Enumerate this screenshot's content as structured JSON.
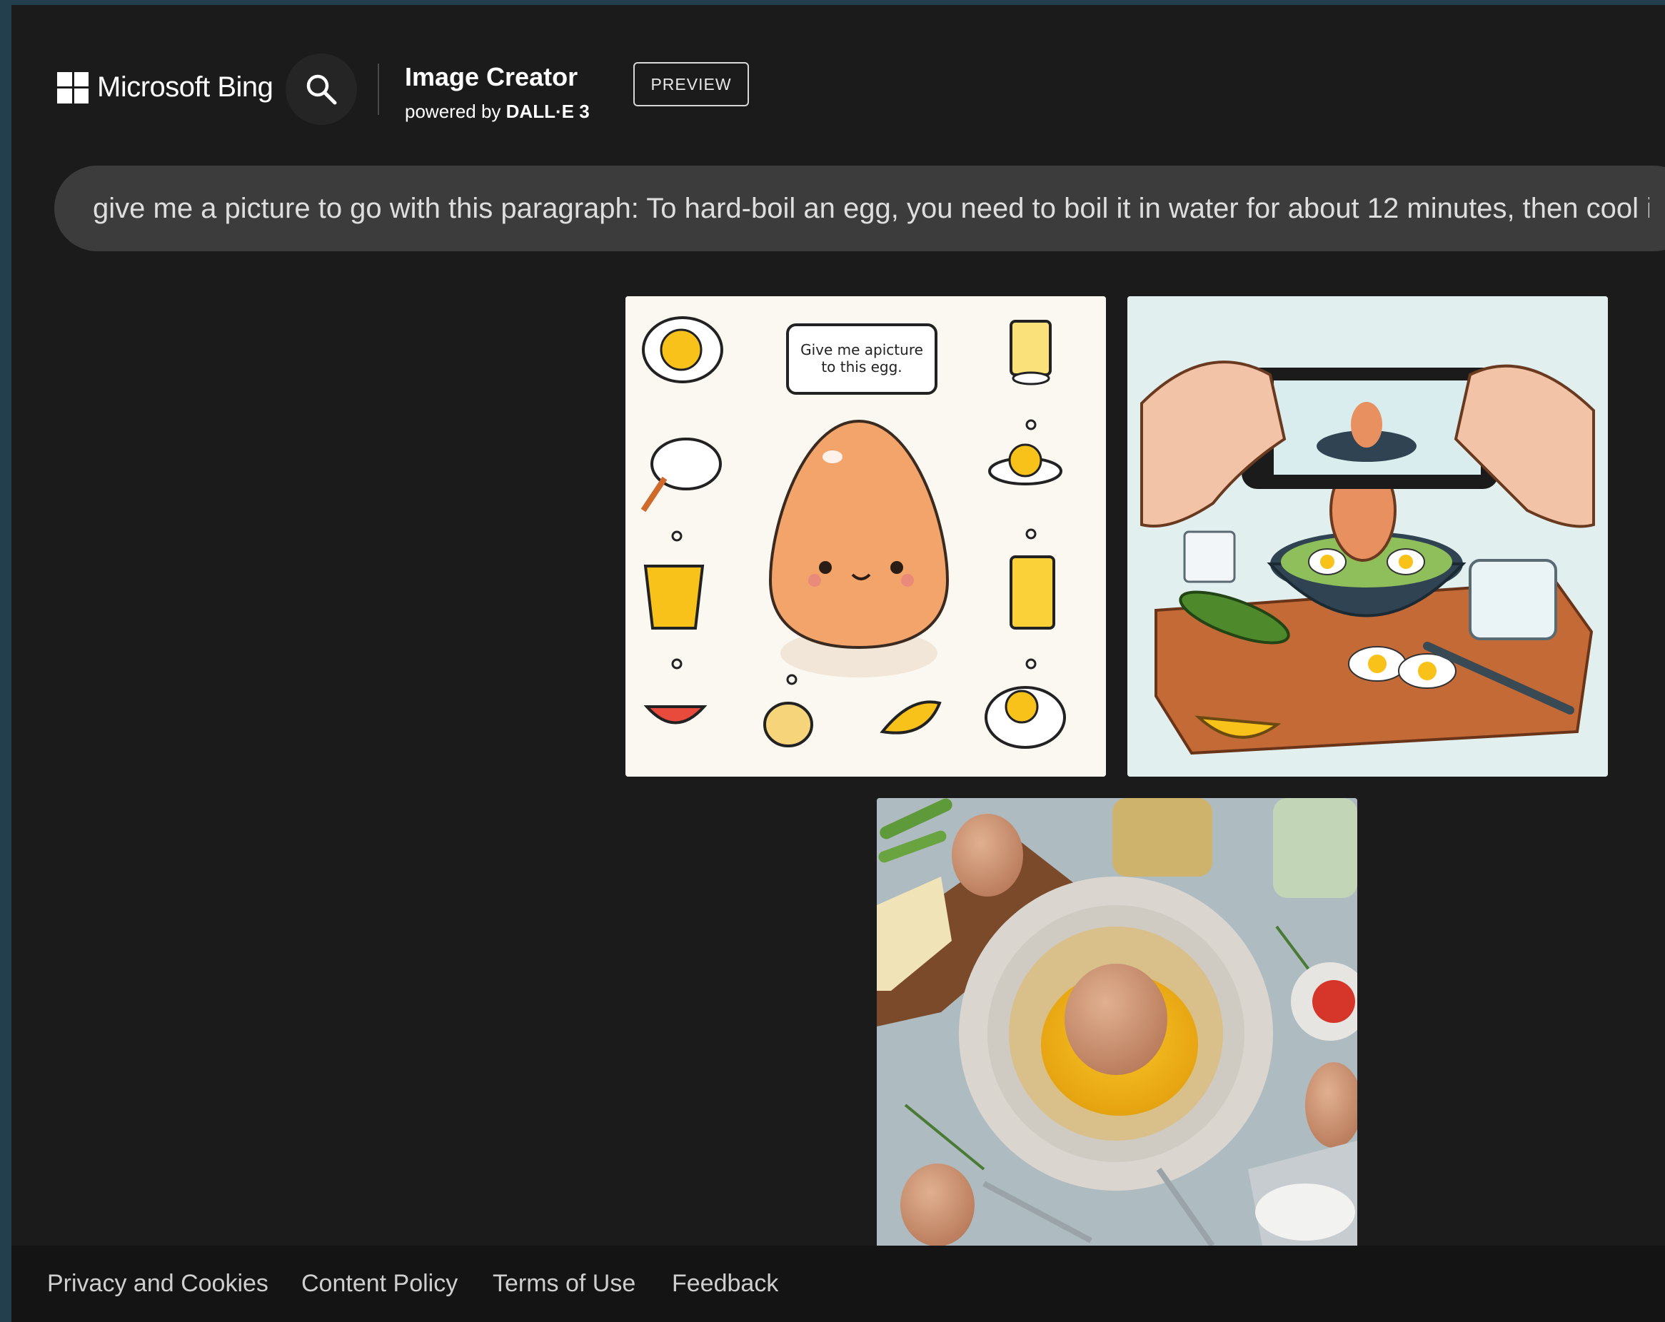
{
  "header": {
    "brand": "Microsoft Bing",
    "app_title": "Image Creator",
    "powered_by_prefix": "powered by ",
    "powered_by_model": "DALL·E 3",
    "preview_badge": "PREVIEW"
  },
  "prompt": {
    "text": "give me a picture to go with this paragraph: To hard-boil an egg, you need to boil it in water for about 12 minutes, then cool it"
  },
  "results": {
    "image1_caption_line1": "Give me apicture",
    "image1_caption_line2": "to this egg."
  },
  "footer": {
    "links": [
      "Privacy and Cookies",
      "Content Policy",
      "Terms of Use",
      "Feedback"
    ]
  },
  "icons": [
    "windows-logo-icon",
    "search-icon"
  ],
  "colors": {
    "background": "#1b1b1b",
    "prompt_bar": "#3c3c3c",
    "footer": "#141414",
    "desktop": "#233e4c"
  }
}
